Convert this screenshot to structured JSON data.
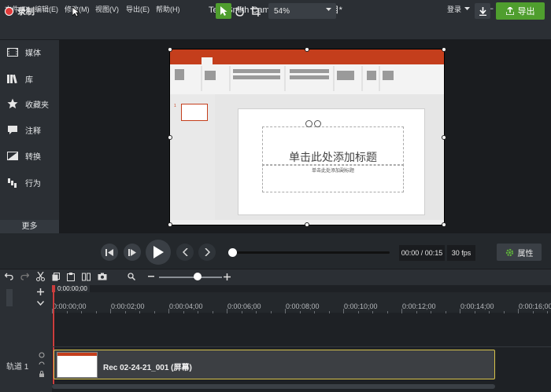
{
  "menu": [
    "文件(F)",
    "编辑(E)",
    "修改(M)",
    "视图(V)",
    "导出(E)",
    "帮助(H)"
  ],
  "app_title": "TechSmith Camtasia - 无标题项目*",
  "login": "登录",
  "window_controls": [
    "—",
    "☐",
    "✕"
  ],
  "record_label": "录制",
  "zoom_value": "54%",
  "export_label": "导出",
  "sidebar": {
    "items": [
      {
        "label": "媒体",
        "icon": "film-icon"
      },
      {
        "label": "库",
        "icon": "library-icon"
      },
      {
        "label": "收藏夹",
        "icon": "star-icon"
      },
      {
        "label": "注释",
        "icon": "callout-icon"
      },
      {
        "label": "转换",
        "icon": "transition-icon"
      },
      {
        "label": "行为",
        "icon": "behavior-icon"
      }
    ],
    "more": "更多"
  },
  "slide": {
    "title_placeholder": "单击此处添加标题",
    "subtitle_placeholder": "单击此处添加副标题",
    "slide_number": "1"
  },
  "playback": {
    "time": "00:00 / 00:15",
    "fps": "30 fps",
    "properties_label": "属性",
    "progress": 0
  },
  "timeline": {
    "playhead_time": "0:00:00;00",
    "ticks": [
      "0:00:00;00",
      "0:00:02;00",
      "0:00:04;00",
      "0:00:06;00",
      "0:00:08;00",
      "0:00:10;00",
      "0:00:12;00",
      "0:00:14;00",
      "0:00:16;00"
    ],
    "track_label": "轨道 1",
    "clip_title": "Rec 02-24-21_001 (屏幕)"
  },
  "colors": {
    "accent_green": "#4f9e2e",
    "record_red": "#e03a3a",
    "clip_border": "#d8c34a",
    "ppt_orange": "#c43e1c"
  }
}
